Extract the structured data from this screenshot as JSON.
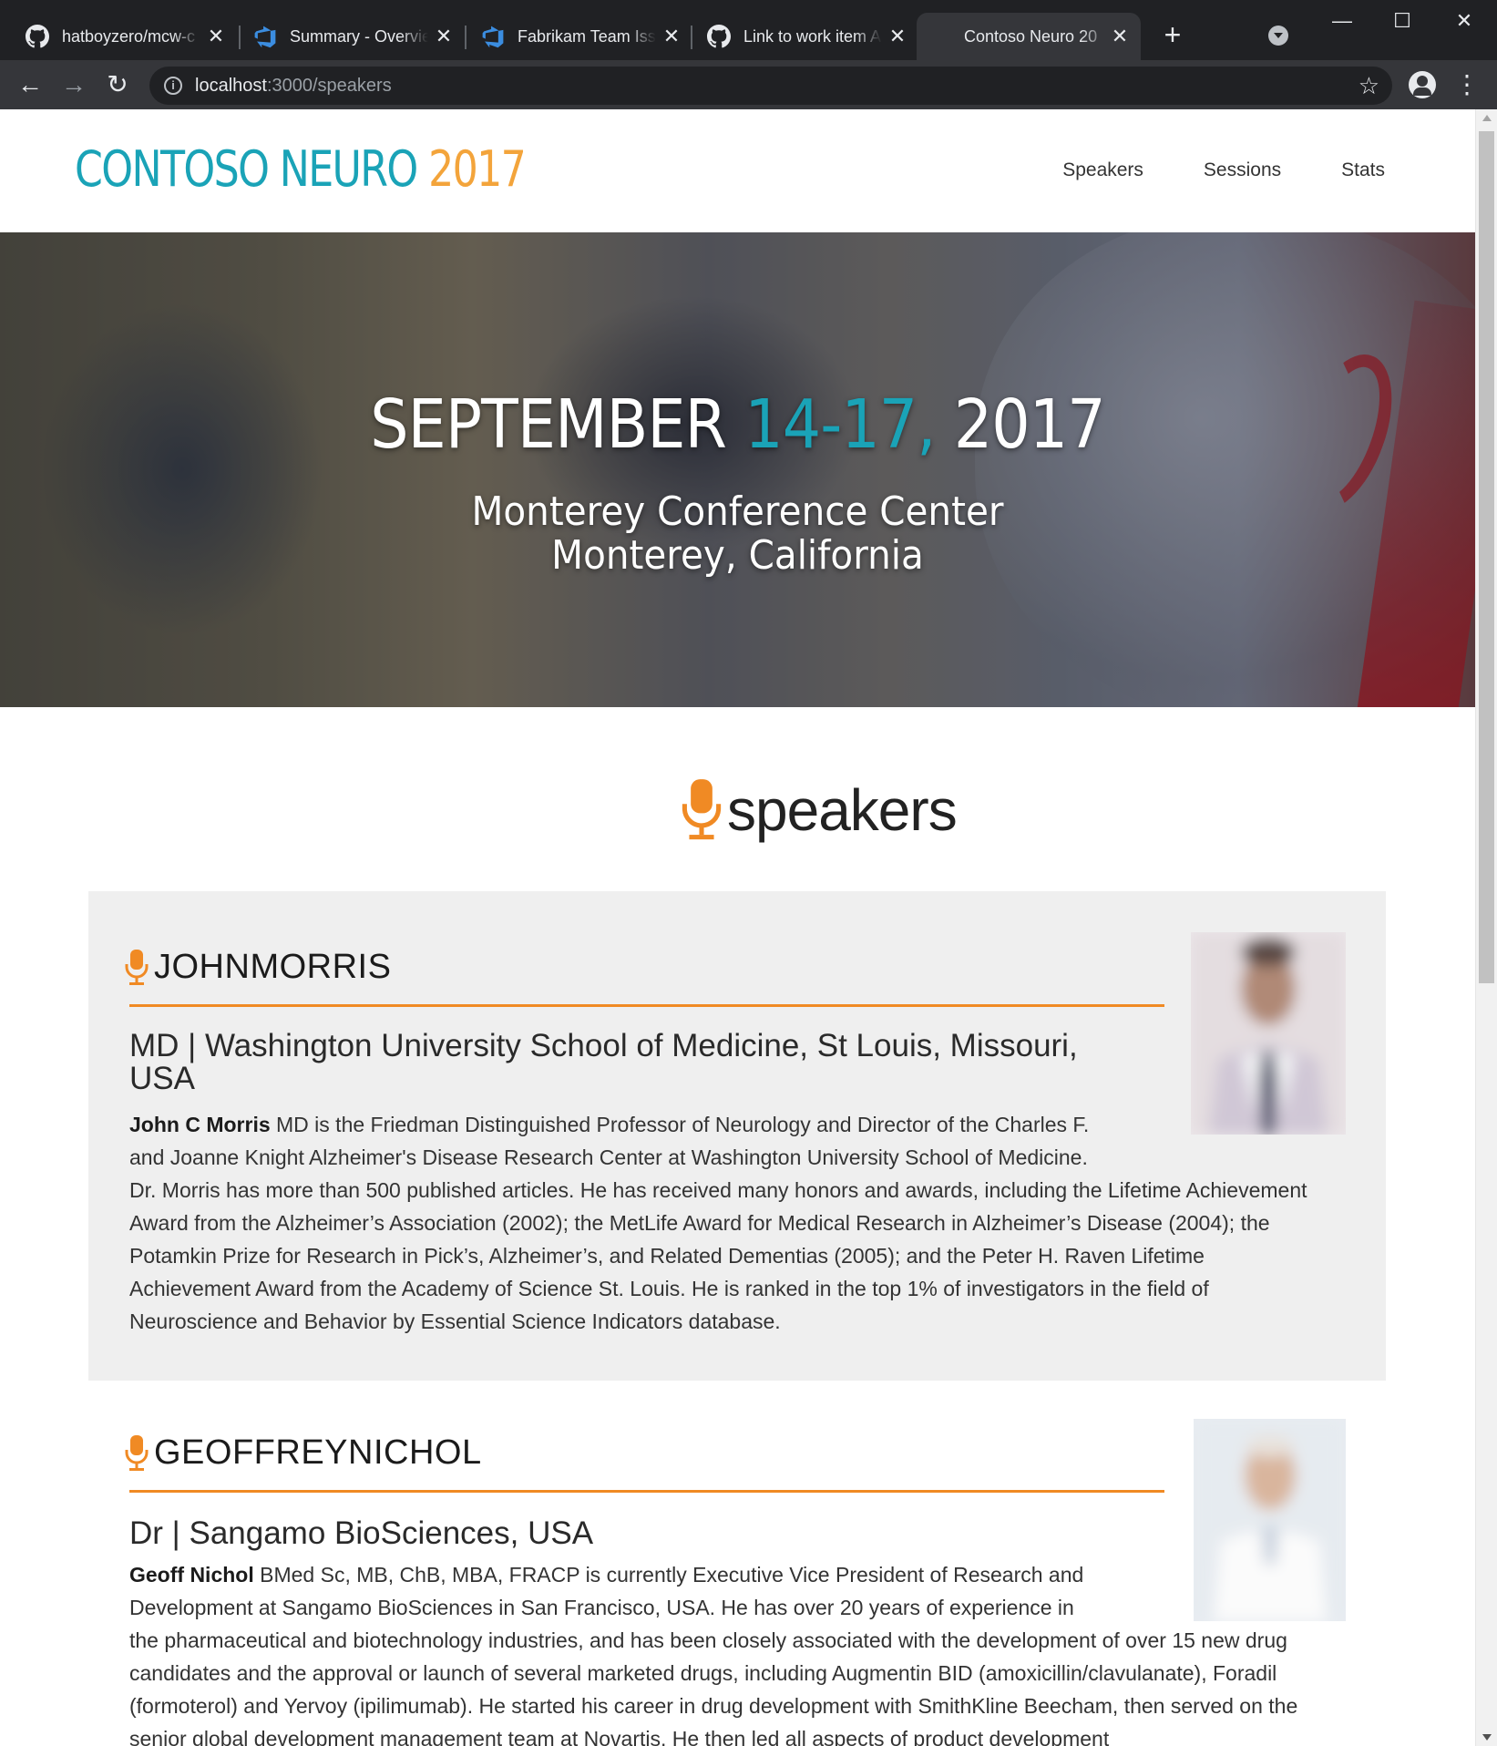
{
  "browser": {
    "tabs": [
      {
        "title": "hatboyzero/mcw-c",
        "icon": "github-icon",
        "active": false
      },
      {
        "title": "Summary - Overvie",
        "icon": "azure-devops-icon",
        "active": false
      },
      {
        "title": "Fabrikam Team Issu",
        "icon": "azure-devops-icon",
        "active": false
      },
      {
        "title": "Link to work item A",
        "icon": "github-icon",
        "active": false
      },
      {
        "title": "Contoso Neuro 20",
        "icon": "",
        "active": true
      }
    ],
    "url_host": "localhost",
    "url_rest": ":3000/speakers",
    "new_tab_label": "+",
    "close_glyph": "✕"
  },
  "site": {
    "logo_brand": "CONTOSO NEURO ",
    "logo_year": "2017",
    "nav": [
      "Speakers",
      "Sessions",
      "Stats"
    ]
  },
  "hero": {
    "date_month": "SEPTEMBER ",
    "date_days": "14-17, ",
    "date_year": "2017",
    "venue_line1": "Monterey Conference Center",
    "venue_line2": "Monterey, California"
  },
  "section": {
    "title": "speakers",
    "icon": "microphone-icon"
  },
  "speakers": [
    {
      "name": "JOHNMORRIS",
      "role": "MD | Washington University School of Medicine, St Louis, Missouri, USA",
      "bio_name": "John C Morris",
      "bio": " MD is the Friedman Distinguished Professor of Neurology and Director of the Charles F. and Joanne Knight Alzheimer's Disease Research Center at Washington University School of Medicine. Dr. Morris has more than 500 published articles. He has received many honors and awards, including the Lifetime Achievement Award from the Alzheimer’s Association (2002); the MetLife Award for Medical Research in Alzheimer’s Disease (2004); the Potamkin Prize for Research in Pick’s, Alzheimer’s, and Related Dementias (2005); and the Peter H. Raven Lifetime Achievement Award from the Academy of Science St. Louis. He is ranked in the top 1% of investigators in the field of Neuroscience and Behavior by Essential Science Indicators database."
    },
    {
      "name": "GEOFFREYNICHOL",
      "role": "Dr | Sangamo BioSciences, USA",
      "bio_name": "Geoff Nichol",
      "bio": " BMed Sc, MB, ChB, MBA, FRACP is currently Executive Vice President of Research and Development at Sangamo BioSciences in San Francisco, USA. He has over 20 years of experience in the pharmaceutical and biotechnology industries, and has been closely associated with the development of over 15 new drug candidates and the approval or launch of several marketed drugs, including Augmentin BID (amoxicillin/clavulanate), Foradil (formoterol) and Yervoy (ipilimumab). He started his career in drug development with SmithKline Beecham, then served on the senior global development management team at Novartis. He then led all aspects of product development"
    }
  ],
  "colors": {
    "brand_teal": "#1aa3b7",
    "brand_orange": "#f3a43b",
    "rule_orange": "#f08a24",
    "card_bg": "#efefef",
    "chrome_dark": "#202124"
  }
}
